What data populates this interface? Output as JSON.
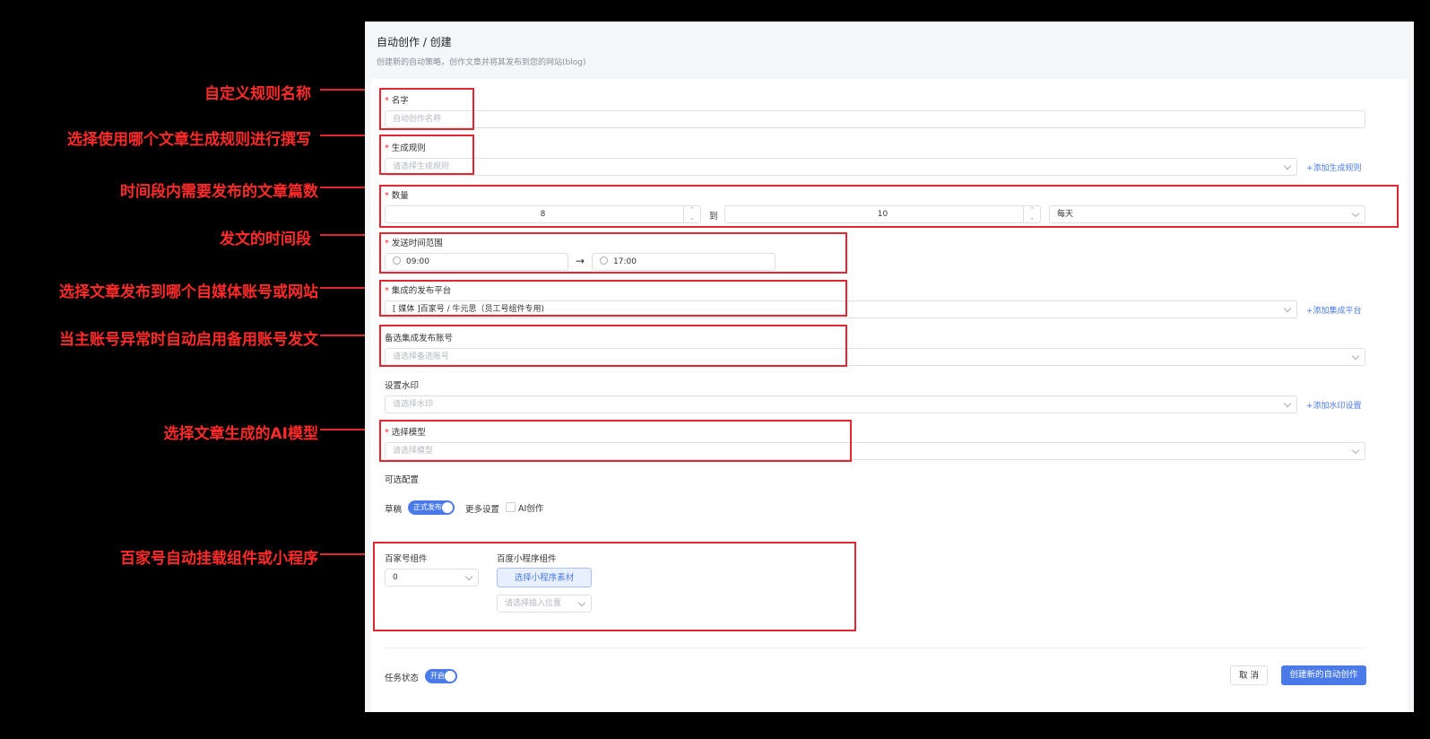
{
  "header": {
    "title": "自动创作 / 创建",
    "subtitle": "创建新的自动策略，创作文章并将其发布到您的网站(blog)"
  },
  "form": {
    "name": {
      "label": "名字",
      "placeholder": "自动创作名称"
    },
    "rule": {
      "label": "生成规则",
      "placeholder": "请选择生成规则",
      "add_link": "添加生成规则"
    },
    "quantity": {
      "label": "数量",
      "min": "8",
      "to": "到",
      "max": "10",
      "period": "每天"
    },
    "time_range": {
      "label": "发送时间范围",
      "start": "09:00",
      "arrow": "→",
      "end": "17:00"
    },
    "platform": {
      "label": "集成的发布平台",
      "value": "[ 媒体 ]百家号 / 牛元思（员工号组件专用)",
      "add_link": "添加集成平台"
    },
    "backup": {
      "label": "备选集成发布账号",
      "placeholder": "请选择备选账号"
    },
    "watermark": {
      "label": "设置水印",
      "placeholder": "请选择水印",
      "add_link": "添加水印设置"
    },
    "model": {
      "label": "选择模型",
      "placeholder": "请选择模型"
    },
    "optional": {
      "label": "可选配置",
      "draft_label": "草稿",
      "publish_toggle": "正式发布",
      "more_settings": "更多设置",
      "ai_create": "AI创作"
    },
    "baijiahao_component": {
      "label": "百家号组件",
      "value": "0"
    },
    "baidu_mini_program": {
      "label": "百度小程序组件",
      "button": "选择小程序素材",
      "position_placeholder": "请选择插入位置"
    },
    "task_status": {
      "label": "任务状态",
      "toggle": "开启"
    },
    "cancel_button": "取 消",
    "submit_button": "创建新的自动创作"
  },
  "annotations": [
    "自定义规则名称",
    "选择使用哪个文章生成规则进行撰写",
    "时间段内需要发布的文章篇数",
    "发文的时间段",
    "选择文章发布到哪个自媒体账号或网站",
    "当主账号异常时自动启用备用账号发文",
    "选择文章生成的AI模型",
    "百家号自动挂载组件或小程序"
  ],
  "colors": {
    "annotation": "#e3262f",
    "accent": "#4a7ae8",
    "background": "#000000"
  }
}
